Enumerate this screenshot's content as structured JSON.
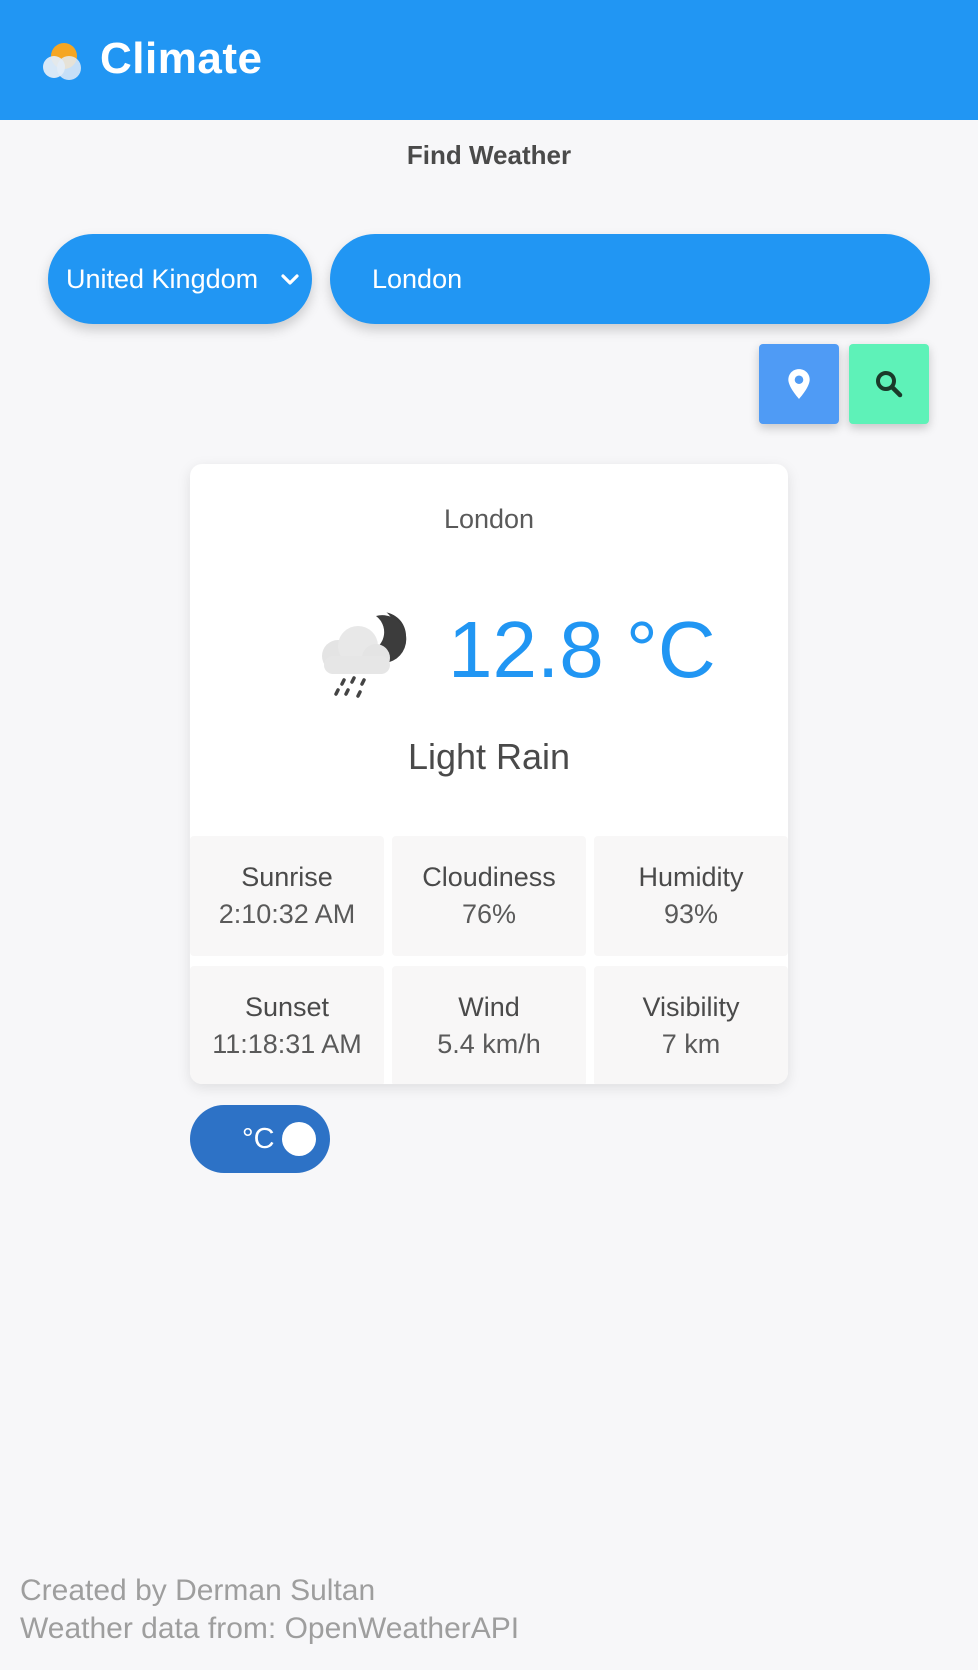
{
  "header": {
    "app_title": "Climate",
    "logo_icon": "sun-cloud-logo-icon",
    "background_color": "#2196f3"
  },
  "search": {
    "heading": "Find Weather",
    "country_select": {
      "selected": "United Kingdom",
      "icon": "chevron-down-icon"
    },
    "city_input": {
      "value": "London"
    },
    "location_button_icon": "map-pin-icon",
    "search_button_icon": "search-icon"
  },
  "weather": {
    "city": "London",
    "icon": "night-rain-cloud-icon",
    "temperature": "12.8 °C",
    "condition": "Light Rain",
    "stats": [
      {
        "label": "Sunrise",
        "value": "2:10:32 AM"
      },
      {
        "label": "Cloudiness",
        "value": "76%"
      },
      {
        "label": "Humidity",
        "value": "93%"
      },
      {
        "label": "Sunset",
        "value": "11:18:31 AM"
      },
      {
        "label": "Wind",
        "value": "5.4 km/h"
      },
      {
        "label": "Visibility",
        "value": "7 km"
      }
    ]
  },
  "unit_toggle": {
    "label": "°C",
    "state": "celsius"
  },
  "footer": {
    "credit": "Created by Derman Sultan",
    "data_source": "Weather data from: OpenWeatherAPI"
  },
  "colors": {
    "accent": "#2196f3",
    "location_button": "#4f9bf5",
    "search_button": "#5ef2b8",
    "toggle": "#2d72c6"
  }
}
